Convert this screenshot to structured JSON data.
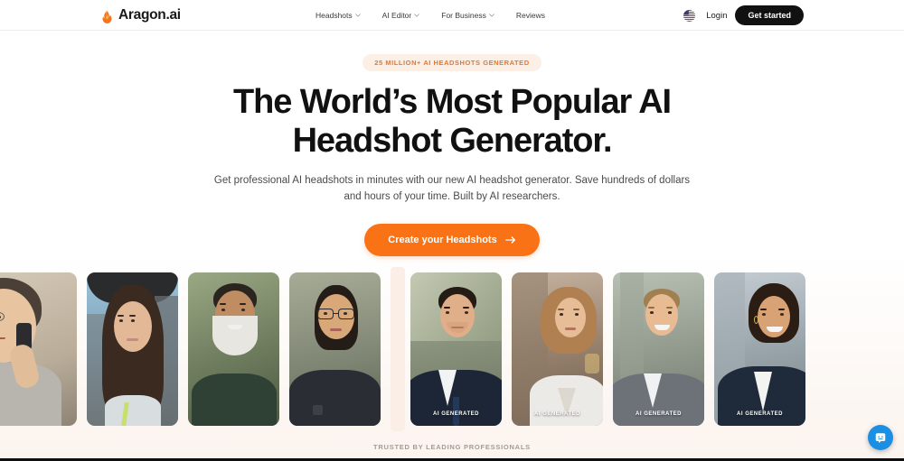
{
  "header": {
    "brand_name": "Aragon.ai",
    "logo_icon": "flame-icon",
    "nav": [
      {
        "label": "Headshots",
        "has_dropdown": true
      },
      {
        "label": "AI Editor",
        "has_dropdown": true
      },
      {
        "label": "For Business",
        "has_dropdown": true
      },
      {
        "label": "Reviews",
        "has_dropdown": false
      }
    ],
    "locale_icon": "us-flag-icon",
    "login_label": "Login",
    "get_started_label": "Get started"
  },
  "hero": {
    "badge": "25 MILLION+ AI HEADSHOTS GENERATED",
    "headline": "The World’s Most Popular AI Headshot Generator.",
    "subheading": "Get professional AI headshots in minutes with our new AI headshot generator. Save hundreds of dollars and hours of your time. Built by AI researchers.",
    "cta_label": "Create your Headshots",
    "cta_icon": "arrow-right-icon"
  },
  "gallery": {
    "ai_generated_label": "AI GENERATED",
    "before": [
      {
        "alt": "older-man-on-phone-selfie",
        "bg": "#c9bfae",
        "skin": "#e8c4a0",
        "hair": "#4a4038",
        "top": "#b8b5ae"
      },
      {
        "alt": "young-woman-car-selfie",
        "bg": "#8fb4cc",
        "skin": "#e3b896",
        "hair": "#3a2a20",
        "top": "#d8dde0"
      },
      {
        "alt": "bearded-man-selfie",
        "bg": "#7c8a6e",
        "skin": "#c08d62",
        "hair": "#2b2520",
        "top": "#2f4035"
      },
      {
        "alt": "woman-glasses-selfie",
        "bg": "#8d9384",
        "skin": "#d9a878",
        "hair": "#241c17",
        "top": "#2a2d33"
      }
    ],
    "after": [
      {
        "alt": "man-navy-suit-headshot",
        "bg": "#9aa48f",
        "skin": "#e0ae88",
        "hair": "#241b14",
        "top": "#1d2636",
        "labelled": true
      },
      {
        "alt": "curly-hair-woman-white-blouse-headshot",
        "bg": "#a89584",
        "skin": "#e6bd97",
        "hair": "#b08050",
        "top": "#eceae6",
        "labelled": true
      },
      {
        "alt": "smiling-man-grey-blazer-headshot",
        "bg": "#9fa9a0",
        "skin": "#e8bb93",
        "hair": "#a08050",
        "top": "#6d7279",
        "labelled": true
      },
      {
        "alt": "smiling-woman-navy-blazer-headshot",
        "bg": "#a6b0b6",
        "skin": "#d9a274",
        "hair": "#2b1c14",
        "top": "#1f2a3a",
        "labelled": true
      }
    ]
  },
  "footer": {
    "trusted_label": "TRUSTED BY LEADING PROFESSIONALS"
  },
  "chat": {
    "icon": "chat-bubble-icon",
    "color": "#1a8fe3"
  },
  "colors": {
    "accent_orange": "#f97316",
    "badge_bg": "#fcefe6",
    "badge_text": "#e8762a",
    "dark": "#111111",
    "page_bg": "#ffffff"
  }
}
